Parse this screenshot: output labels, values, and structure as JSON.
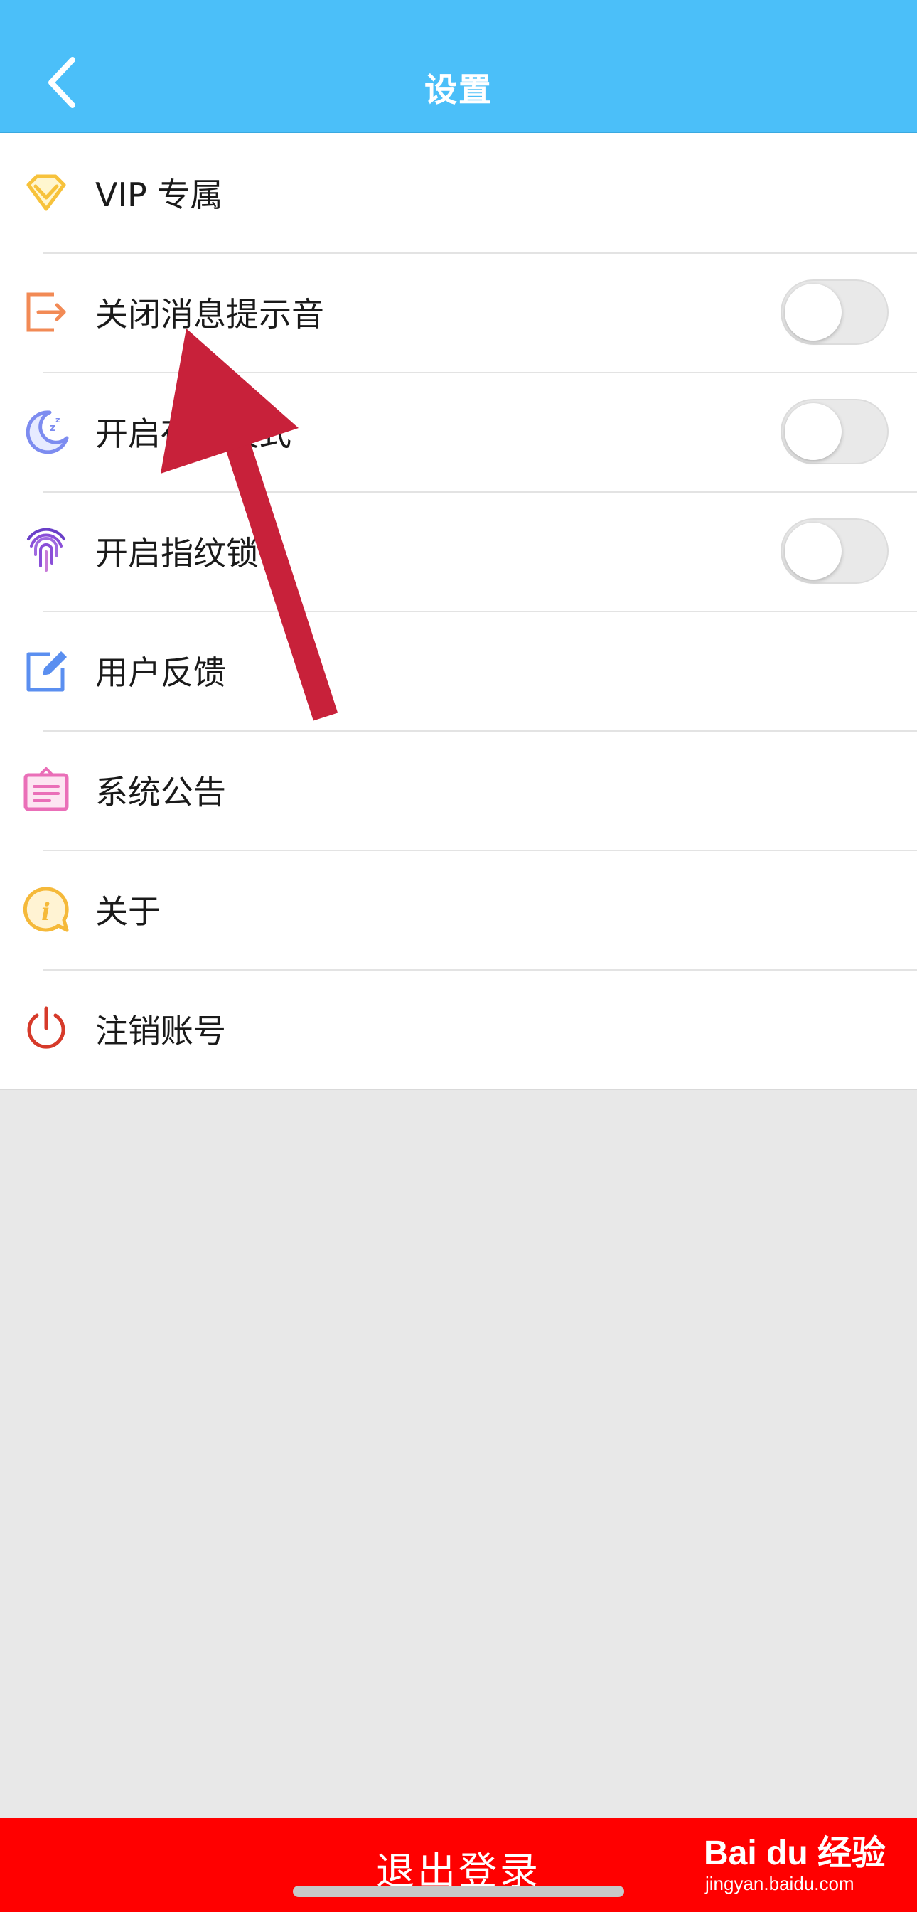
{
  "header": {
    "title": "设置",
    "background": "#4bbff9"
  },
  "menu": {
    "items": [
      {
        "label": "VIP 专属",
        "icon": "diamond-icon",
        "color": "#f7c23b"
      },
      {
        "label": "关闭消息提示音",
        "icon": "exit-arrow-icon",
        "color": "#f28a55",
        "toggle": false
      },
      {
        "label": "开启夜间模式",
        "icon": "moon-icon",
        "color": "#7d8cf0",
        "toggle": false
      },
      {
        "label": "开启指纹锁",
        "icon": "fingerprint-icon",
        "color": "#8a4fd8",
        "toggle": false
      },
      {
        "label": "用户反馈",
        "icon": "edit-icon",
        "color": "#5b8ff0"
      },
      {
        "label": "系统公告",
        "icon": "notice-board-icon",
        "color": "#ea6fb8"
      },
      {
        "label": "关于",
        "icon": "info-icon",
        "color": "#f5b93a"
      },
      {
        "label": "注销账号",
        "icon": "power-icon",
        "color": "#d63a2a"
      }
    ]
  },
  "logout": {
    "label": "退出登录",
    "background": "#ff0000"
  },
  "watermark": {
    "logo": "Bai du 经验",
    "url": "jingyan.baidu.com"
  },
  "annotation": {
    "color": "#c8213a"
  }
}
